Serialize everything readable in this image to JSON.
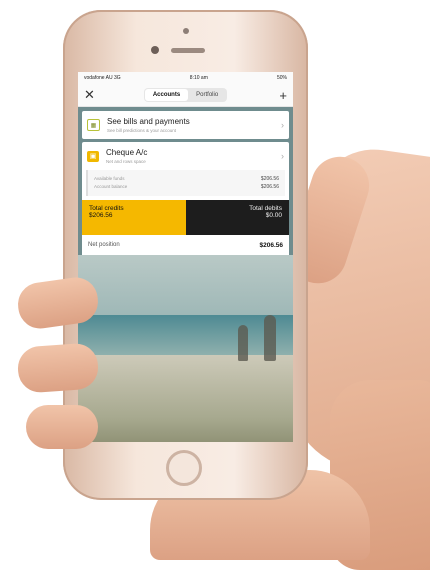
{
  "status_bar": {
    "carrier": "vodafone AU 3G",
    "time": "8:10 am",
    "battery": "50%"
  },
  "nav": {
    "close_icon": "close-icon",
    "tabs": [
      {
        "label": "Accounts",
        "active": true
      },
      {
        "label": "Portfolio",
        "active": false
      }
    ],
    "add_icon": "plus-icon"
  },
  "bills": {
    "title": "See bills and payments",
    "subtitle": "See bill predictions & your account",
    "icon": "calendar-icon"
  },
  "account": {
    "title": "Cheque A/c",
    "subtitle": "Net and rows space",
    "icon": "wallet-icon",
    "rows": [
      {
        "label": "Available funds",
        "value": "$206.56"
      },
      {
        "label": "Account balance",
        "value": "$206.56"
      }
    ]
  },
  "totals": {
    "credits_label": "Total credits",
    "credits_value": "$206.56",
    "debits_label": "Total debits",
    "debits_value": "$0.00"
  },
  "net": {
    "label": "Net position",
    "value": "$206.56"
  },
  "colors": {
    "credits": "#f5b800",
    "debits": "#1d1d1d",
    "background_teal": "#6f8c8e"
  }
}
